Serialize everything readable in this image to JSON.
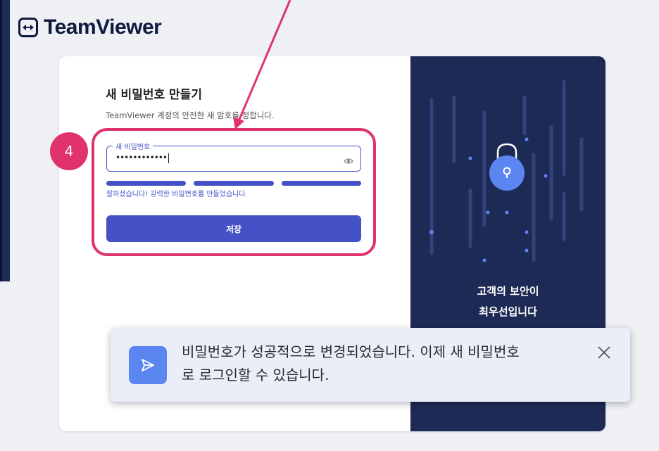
{
  "brand": {
    "name": "TeamViewer"
  },
  "form": {
    "title": "새 비밀번호 만들기",
    "subtitle": "TeamViewer 계정의 안전한 새 암호를 정합니다.",
    "password_label": "새 비밀번호",
    "password_value": "••••••••••••",
    "strength_message": "잘하셨습니다! 강력한 비밀번호를 만들었습니다.",
    "save_label": "저장"
  },
  "annotation": {
    "step_number": "4"
  },
  "side_panel": {
    "line1": "고객의 보안이",
    "line2": "최우선입니다"
  },
  "toast": {
    "message": "비밀번호가 성공적으로 변경되었습니다. 이제 새 비밀번호로 로그인할 수 있습니다."
  },
  "colors": {
    "accent": "#4451c7",
    "highlight": "#e0336b",
    "panel": "#1d2a55",
    "toast_icon": "#5b86f2"
  },
  "icons": [
    "teamviewer-logo-icon",
    "eye-icon",
    "lock-icon",
    "send-icon",
    "close-icon"
  ]
}
